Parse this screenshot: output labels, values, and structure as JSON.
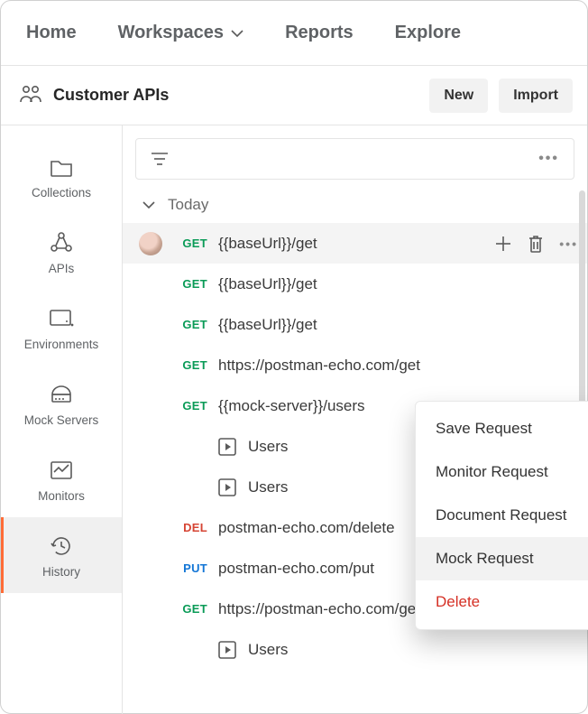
{
  "topnav": {
    "home": "Home",
    "workspaces": "Workspaces",
    "reports": "Reports",
    "explore": "Explore"
  },
  "header": {
    "workspace_title": "Customer APIs",
    "new_button": "New",
    "import_button": "Import"
  },
  "sidebar": {
    "items": [
      {
        "label": "Collections",
        "icon": "folder-icon"
      },
      {
        "label": "APIs",
        "icon": "api-icon"
      },
      {
        "label": "Environments",
        "icon": "environments-icon"
      },
      {
        "label": "Mock Servers",
        "icon": "server-icon"
      },
      {
        "label": "Monitors",
        "icon": "monitor-icon"
      },
      {
        "label": "History",
        "icon": "history-icon"
      }
    ],
    "selected_index": 5
  },
  "history": {
    "group_label": "Today",
    "items": [
      {
        "method": "GET",
        "method_class": "get",
        "url": "{{baseUrl}}/get",
        "avatar": true,
        "selected": true,
        "show_row_actions": true
      },
      {
        "method": "GET",
        "method_class": "get",
        "url": "{{baseUrl}}/get"
      },
      {
        "method": "GET",
        "method_class": "get",
        "url": "{{baseUrl}}/get"
      },
      {
        "method": "GET",
        "method_class": "get",
        "url": "https://postman-echo.com/get"
      },
      {
        "method": "GET",
        "method_class": "get",
        "url": "{{mock-server}}/users"
      },
      {
        "method": "",
        "method_class": "",
        "url": "Users",
        "square": true
      },
      {
        "method": "",
        "method_class": "",
        "url": "Users",
        "square": true
      },
      {
        "method": "DEL",
        "method_class": "del",
        "url": "postman-echo.com/delete"
      },
      {
        "method": "PUT",
        "method_class": "put",
        "url": "postman-echo.com/put"
      },
      {
        "method": "GET",
        "method_class": "get",
        "url": "https://postman-echo.com/get"
      },
      {
        "method": "",
        "method_class": "",
        "url": "Users",
        "square": true
      }
    ]
  },
  "context_menu": {
    "items": [
      {
        "label": "Save Request"
      },
      {
        "label": "Monitor Request"
      },
      {
        "label": "Document Request"
      },
      {
        "label": "Mock Request",
        "hover": true
      },
      {
        "label": "Delete",
        "danger": true
      }
    ]
  }
}
